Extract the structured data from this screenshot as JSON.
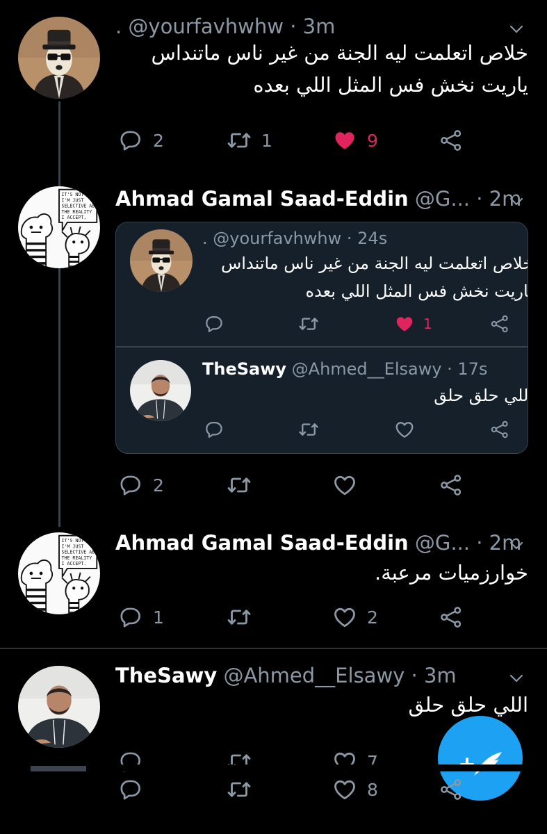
{
  "tweets": [
    {
      "header": {
        "name": "",
        "handle": ". @yourfavhwhw",
        "time": " · 3m"
      },
      "lines": [
        "خلاص اتعلمت ليه الجنة من غير ناس ماتنداس",
        "ياريت نخش فس المثل اللي بعده"
      ],
      "actions": {
        "replies": "2",
        "retweets": "1",
        "likes": "9",
        "liked": true
      }
    },
    {
      "header": {
        "name": "Ahmad Gamal Saad-Eddin",
        "handle": " @G...",
        "time": " · 2m"
      },
      "quoted": [
        {
          "header": {
            "name": "",
            "handle": ". @yourfavhwhw",
            "time": " · 24s"
          },
          "lines": [
            "خلاص اتعلمت ليه الجنة من غير ناس ماتنداس",
            "ياريت نخش فس المثل اللي بعده"
          ],
          "actions": {
            "likes": "1",
            "liked": true
          }
        },
        {
          "header": {
            "name": "TheSawy",
            "handle": " @Ahmed__Elsawy",
            "time": " · 17s"
          },
          "lines": [
            "اللي حلق حلق"
          ],
          "actions": {
            "likes": ""
          }
        }
      ],
      "actions": {
        "replies": "2",
        "retweets": "",
        "likes": ""
      }
    },
    {
      "header": {
        "name": "Ahmad Gamal Saad-Eddin",
        "handle": " @G...",
        "time": " · 2m"
      },
      "lines": [
        "خوارزميات مرعبة."
      ],
      "actions": {
        "replies": "1",
        "retweets": "",
        "likes": "2"
      }
    },
    {
      "header": {
        "name": "TheSawy",
        "handle": " @Ahmed__Elsawy",
        "time": " · 3m"
      },
      "lines": [
        "اللي حلق حلق"
      ],
      "actions": {
        "replies": "",
        "retweets": "",
        "likes": "8",
        "likes_ghost": "7"
      }
    }
  ],
  "comic_text": [
    "IT'S NOT",
    "I'M JUST",
    "SELECTIVE AB",
    "THE REALITY",
    "I ACCEPT."
  ],
  "fab_icon": "compose-tweet-icon",
  "colors": {
    "background": "#000000",
    "card": "#15202b",
    "border": "#38444d",
    "muted": "#8b98a5",
    "like": "#e0245e",
    "accent": "#1da1f2"
  }
}
